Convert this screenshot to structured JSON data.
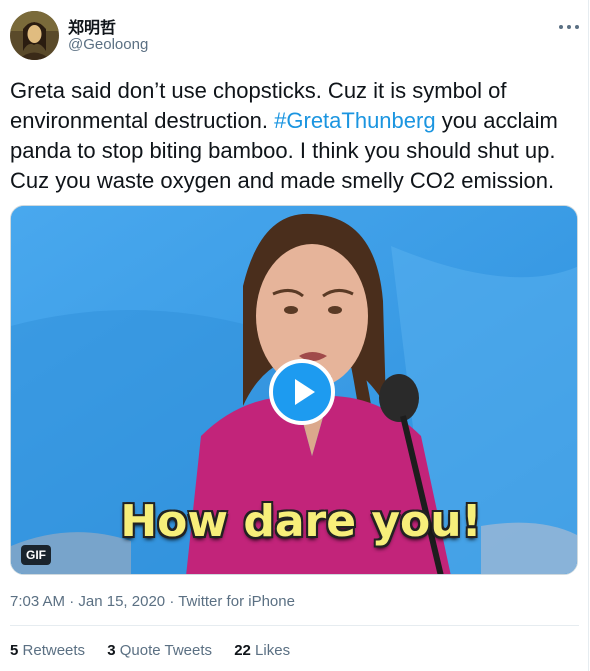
{
  "author": {
    "display_name": "郑明哲",
    "handle": "@Geoloong"
  },
  "tweet": {
    "text_before": "Greta said don’t use chopsticks. Cuz it is symbol of environmental destruction. ",
    "hashtag": "#GretaThunberg",
    "text_after": " you acclaim panda to stop biting bamboo. I think you should shut up. Cuz you waste oxygen and made smelly CO2 emission."
  },
  "media": {
    "caption": "How dare you!",
    "badge": "GIF"
  },
  "meta": {
    "time": "7:03 AM",
    "date": "Jan 15, 2020",
    "source": "Twitter for iPhone"
  },
  "stats": {
    "retweets_count": "5",
    "retweets_label": "Retweets",
    "quotes_count": "3",
    "quotes_label": "Quote Tweets",
    "likes_count": "22",
    "likes_label": "Likes"
  },
  "colors": {
    "accent": "#1b95e0",
    "secondary_text": "#5b7083",
    "caption": "#f7ef7a"
  }
}
